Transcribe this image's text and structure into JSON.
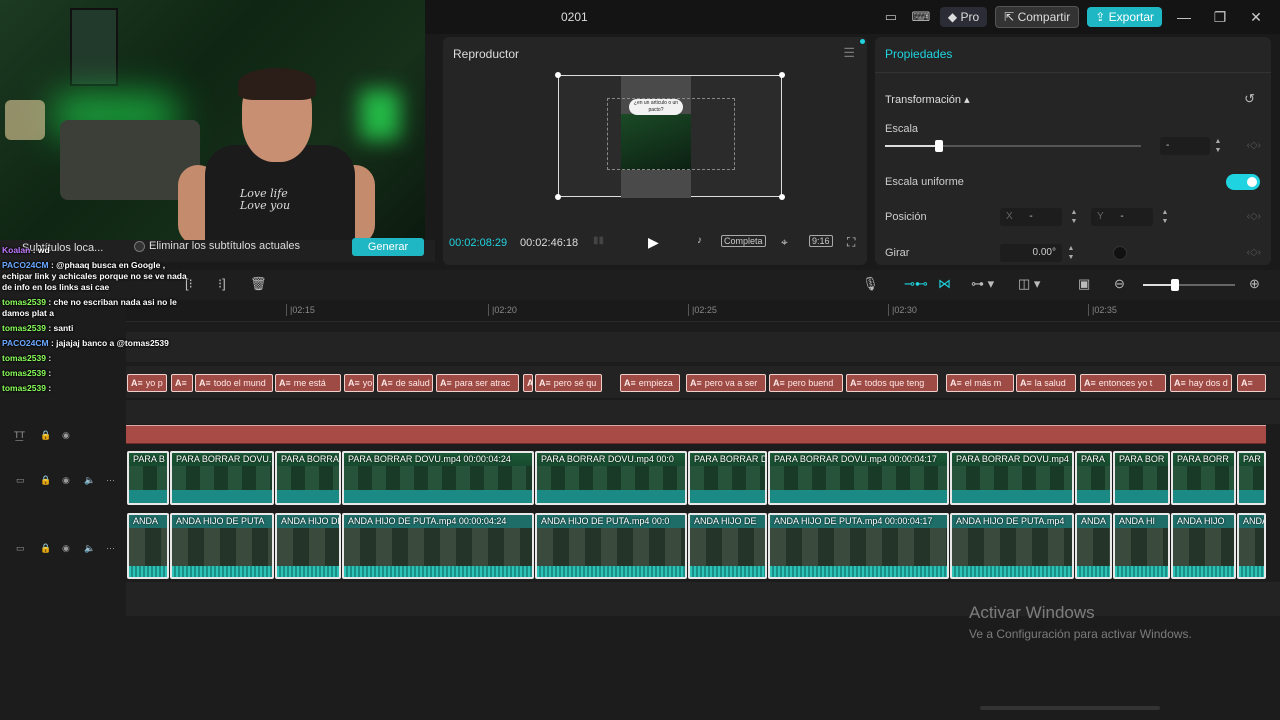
{
  "title": "0201",
  "titlebar": {
    "pro_label": "Pro",
    "share_label": "Compartir",
    "export_label": "Exportar",
    "minimize": "—",
    "maximize": "❐",
    "close": "✕"
  },
  "webcam": {
    "shirt_text": "Love life Love you"
  },
  "subtitles_bar": {
    "subs_label": "Subtítulos loca...",
    "remove_label": "Eliminar los subtítulos actuales",
    "generate_label": "Generar"
  },
  "chat": [
    {
      "user": "Koalan",
      "msg": "wd"
    },
    {
      "user": "PACO24CM",
      "msg": "@phaaq busca en Google , echipar link y achicales porque no se ve nada de info en los links asi cae"
    },
    {
      "user": "tomas2539",
      "msg": "che no escriban nada asi no le damos plat a"
    },
    {
      "user": "tomas2539",
      "msg": "santi"
    },
    {
      "user": "PACO24CM",
      "msg": "jajajaj banco a @tomas2539"
    },
    {
      "user": "tomas2539",
      "msg": ""
    },
    {
      "user": "tomas2539",
      "msg": ""
    },
    {
      "user": "tomas2539",
      "msg": ""
    }
  ],
  "player": {
    "title": "Reproductor",
    "bubble": "¿en un articulo o un pacto?",
    "time_current": "00:02:08:29",
    "time_total": "00:02:46:18",
    "full_label": "Completa",
    "ratio_label": "9:16"
  },
  "properties": {
    "tab": "Propiedades",
    "section": "Transformación",
    "scale_label": "Escala",
    "scale_value": "-",
    "scale_fraction": 0.21,
    "uniform_label": "Escala uniforme",
    "position_label": "Posición",
    "x_label": "X",
    "x_value": "-",
    "y_label": "Y",
    "y_value": "-",
    "rotate_label": "Girar",
    "rotate_value": "0.00°"
  },
  "ruler": [
    "|02:15",
    "|02:20",
    "|02:25",
    "|02:30",
    "|02:35"
  ],
  "caption_clips": [
    "yo p",
    "",
    "todo el mund",
    "me está",
    "yo",
    "de salud",
    "para ser atrac",
    "",
    "pero sé qu",
    "empieza",
    "pero va a ser",
    "pero buend",
    "todos que teng",
    "el más m",
    "la salud",
    "entonces yo t",
    "hay dos d",
    ""
  ],
  "video_clips": [
    {
      "label": "PARA B"
    },
    {
      "label": "PARA BORRAR DOVU.mp4"
    },
    {
      "label": "PARA BORRA"
    },
    {
      "label": "PARA BORRAR DOVU.mp4   00:00:04:24"
    },
    {
      "label": "PARA BORRAR DOVU.mp4   00:0"
    },
    {
      "label": "PARA BORRAR D"
    },
    {
      "label": "PARA BORRAR DOVU.mp4   00:00:04:17"
    },
    {
      "label": "PARA BORRAR DOVU.mp4"
    },
    {
      "label": "PARA"
    },
    {
      "label": "PARA BOR"
    },
    {
      "label": "PARA BORR"
    },
    {
      "label": "PAR"
    }
  ],
  "audio_clips": [
    {
      "label": "ANDA"
    },
    {
      "label": "ANDA HIJO DE PUTA"
    },
    {
      "label": "ANDA HIJO DE"
    },
    {
      "label": "ANDA HIJO DE PUTA.mp4   00:00:04:24"
    },
    {
      "label": "ANDA HIJO DE PUTA.mp4   00:0"
    },
    {
      "label": "ANDA HIJO DE"
    },
    {
      "label": "ANDA HIJO DE PUTA.mp4   00:00:04:17"
    },
    {
      "label": "ANDA HIJO DE PUTA.mp4"
    },
    {
      "label": "ANDA"
    },
    {
      "label": "ANDA HI"
    },
    {
      "label": "ANDA HIJO"
    },
    {
      "label": "ANDA"
    }
  ],
  "watermark": {
    "line1": "Activar Windows",
    "line2": "Ve a Configuración para activar Windows."
  },
  "colors": {
    "accent": "#1fb7c4",
    "caption": "#9e4a45",
    "video": "#1d8d7f"
  }
}
